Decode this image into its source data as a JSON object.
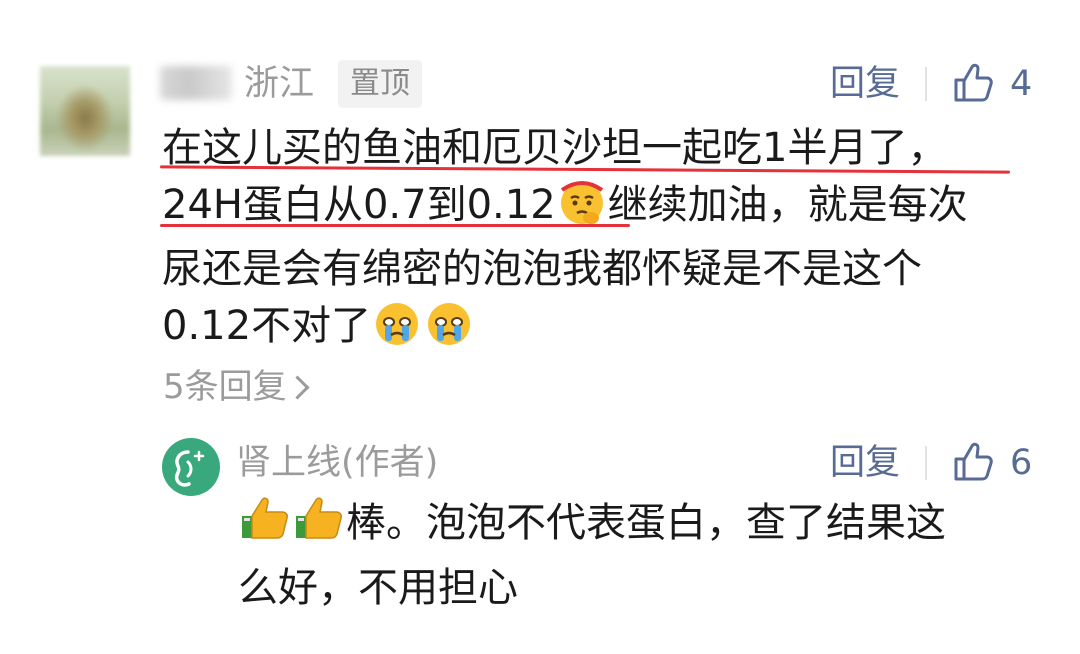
{
  "comment": {
    "location": "浙江",
    "pinned_badge": "置顶",
    "reply_label": "回复",
    "like_count": "4",
    "text_line1": "在这儿买的鱼油和厄贝沙坦一起吃1半月了，",
    "text_line2a": "24H蛋白从0.7到0.12",
    "text_line2b": "继续加油，就是每次",
    "text_line3": "尿还是会有绵密的泡泡我都怀疑是不是这个",
    "text_line4": "0.12不对了",
    "more_replies": "5条回复",
    "emojis": [
      "thinking-face-emoji",
      "crying-face-emoji",
      "crying-face-emoji"
    ]
  },
  "author_reply": {
    "name": "肾上线(作者)",
    "reply_label": "回复",
    "like_count": "6",
    "text_line1": "棒。泡泡不代表蛋白，查了结果这",
    "text_line2": "么好，不用担心",
    "emojis": [
      "thumbs-up-emoji",
      "thumbs-up-emoji"
    ]
  },
  "colors": {
    "link": "#576b95",
    "muted": "#9b9b9b",
    "highlight_underline": "#e4313a",
    "author_avatar": "#3aa87d"
  }
}
